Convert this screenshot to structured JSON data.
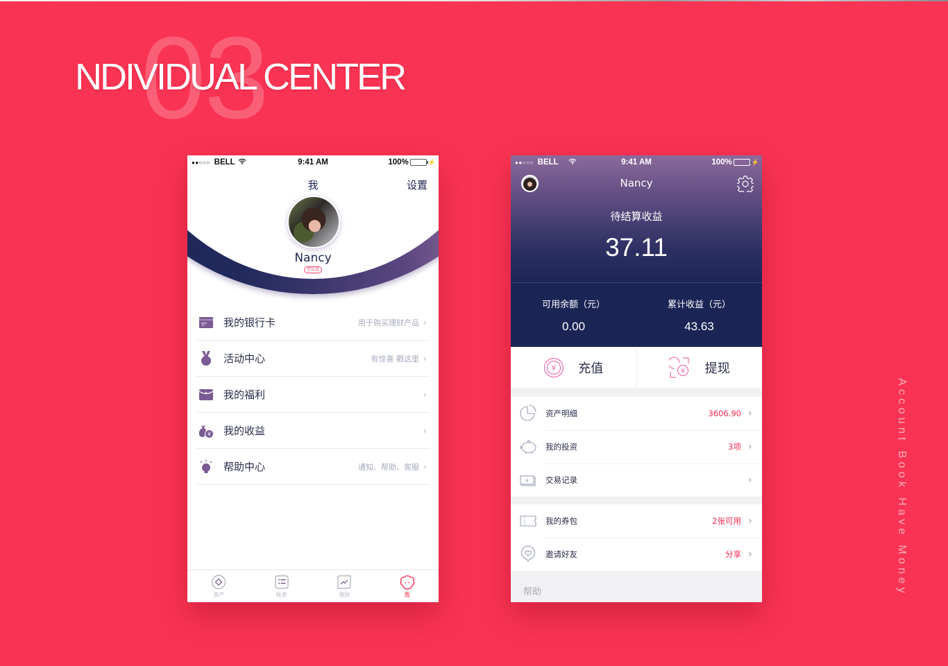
{
  "hero": {
    "number": "03",
    "title": "NDIVIDUAL CENTER",
    "side_text": "Account Book Have Money"
  },
  "status_bar": {
    "signal": "●●○○○",
    "carrier": "BELL",
    "time": "9:41 AM",
    "battery": "100%"
  },
  "left_phone": {
    "title": "我",
    "settings_label": "设置",
    "user_name": "Nancy",
    "verified_badge": "已认证",
    "menu": [
      {
        "label": "我的银行卡",
        "hint": "用于购买理财产品",
        "icon": "bank-card-icon"
      },
      {
        "label": "活动中心",
        "hint": "有惊喜 戳这里",
        "icon": "medal-icon"
      },
      {
        "label": "我的福利",
        "hint": "",
        "icon": "wallet-icon"
      },
      {
        "label": "我的收益",
        "hint": "",
        "icon": "money-bag-icon"
      },
      {
        "label": "帮助中心",
        "hint": "通知、帮助、客服",
        "icon": "lightbulb-icon"
      }
    ],
    "tabs": [
      {
        "label": "资产",
        "icon": "assets-icon",
        "active": false
      },
      {
        "label": "账单",
        "icon": "bill-icon",
        "active": false
      },
      {
        "label": "理财",
        "icon": "finance-chart-icon",
        "active": false
      },
      {
        "label": "我",
        "icon": "profile-face-icon",
        "active": true
      }
    ]
  },
  "right_phone": {
    "user_name": "Nancy",
    "pending_label": "待结算收益",
    "pending_value": "37.11",
    "available_label": "可用余额（元）",
    "available_value": "0.00",
    "total_label": "累计收益（元）",
    "total_value": "43.63",
    "recharge_label": "充值",
    "withdraw_label": "提现",
    "list_1": [
      {
        "label": "资产明细",
        "value": "3606.90",
        "icon": "pie-chart-icon"
      },
      {
        "label": "我的投资",
        "value": "3项",
        "icon": "piggy-bank-icon"
      },
      {
        "label": "交易记录",
        "value": "",
        "icon": "cash-record-icon"
      }
    ],
    "list_2": [
      {
        "label": "我的券包",
        "value": "2张可用",
        "icon": "ticket-icon"
      },
      {
        "label": "邀请好友",
        "value": "分享",
        "icon": "heart-chat-icon"
      }
    ],
    "help_label": "帮助"
  },
  "colors": {
    "background": "#f93353",
    "navy": "#1b2555",
    "purple": "#7a5a93",
    "accent_red": "#f3294d"
  }
}
